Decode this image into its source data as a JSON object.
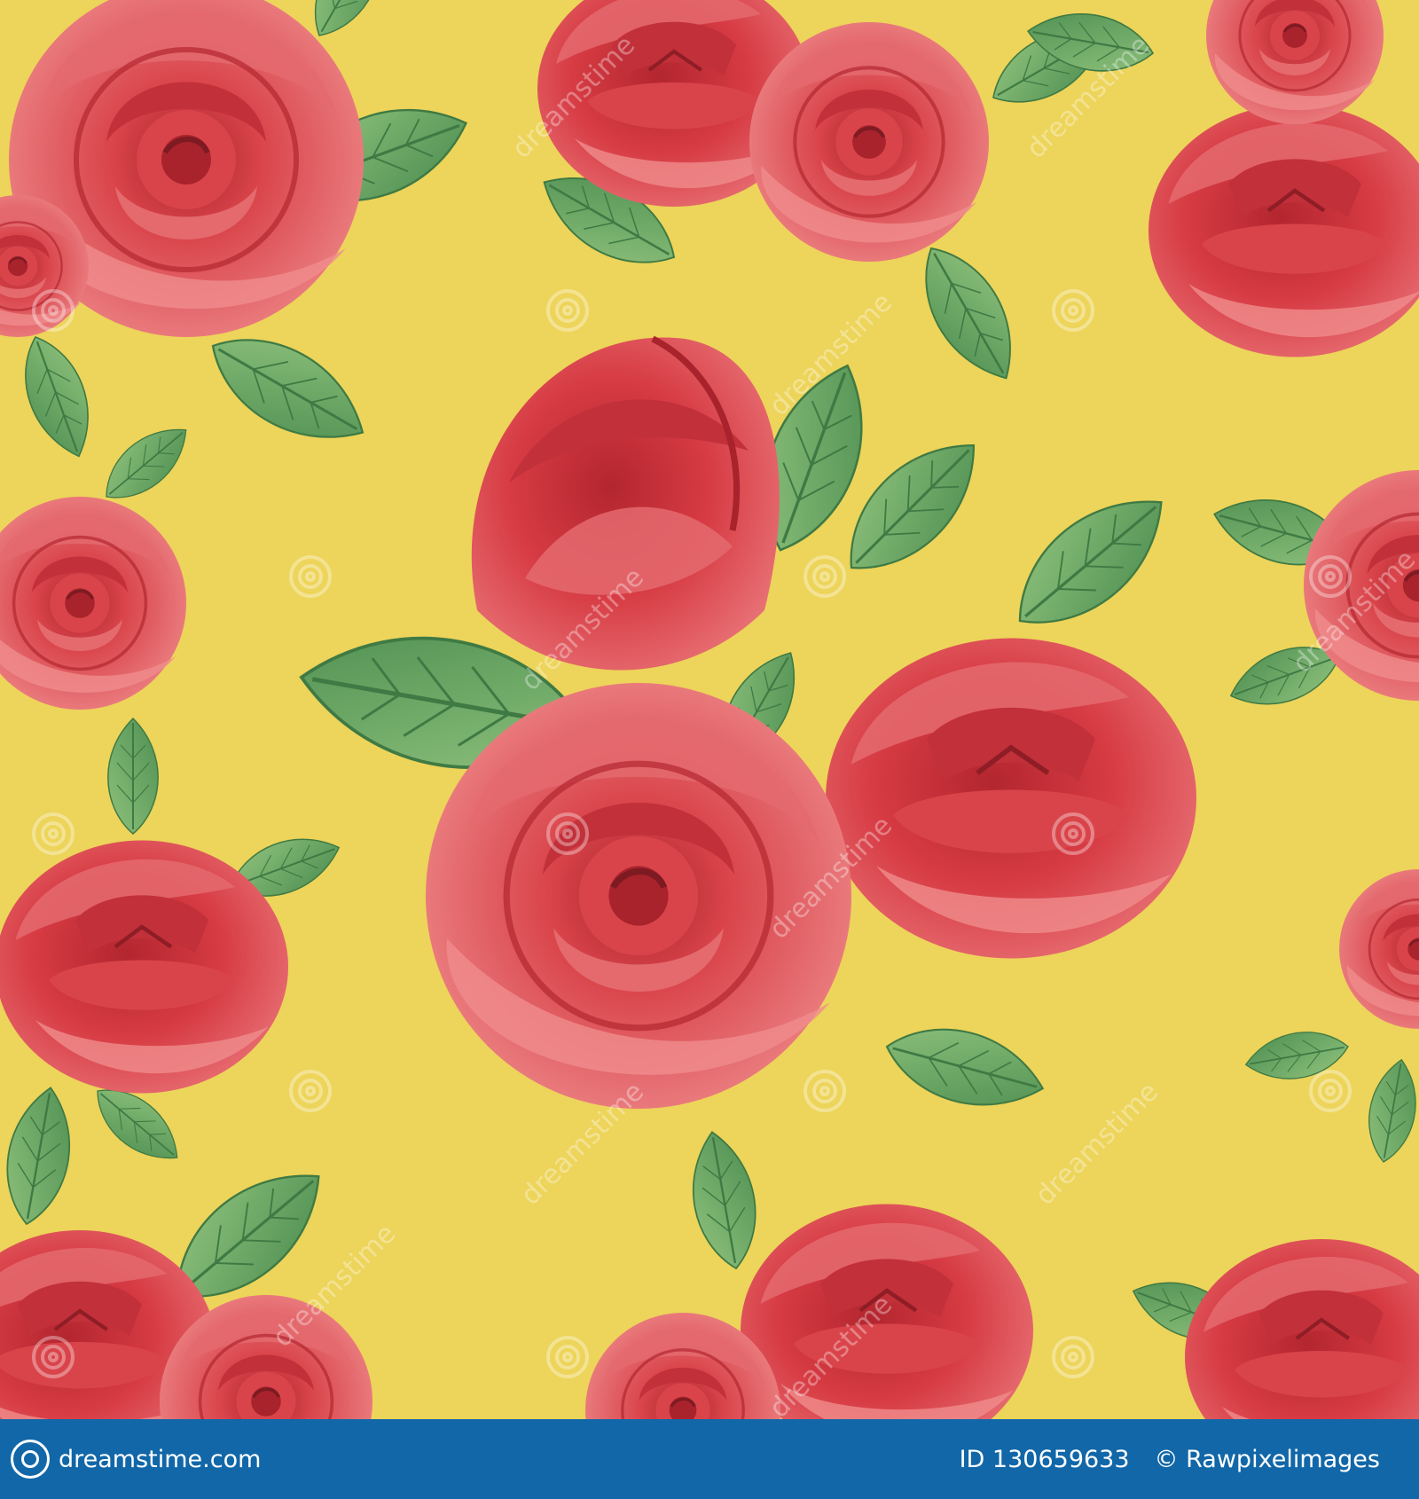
{
  "image": {
    "subject": "seamless watercolor pattern of red roses with green leaves",
    "background_color": "#EDD45A",
    "rose_colors": [
      "#D9444A",
      "#C2303A",
      "#E46A6E",
      "#F08C8C",
      "#A8232C"
    ],
    "leaf_colors": [
      "#6DAE6A",
      "#8FC27C",
      "#4E8F52",
      "#B7CF9A"
    ],
    "watermark_text": "dreamstime"
  },
  "footer": {
    "background_color": "#1167A8",
    "site": "dreamstime.com",
    "image_id": "ID 130659633",
    "credit": "© Rawpixelimages"
  }
}
